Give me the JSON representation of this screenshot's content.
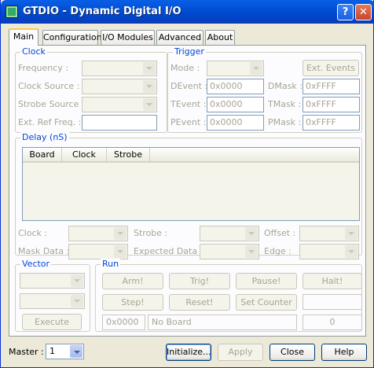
{
  "window": {
    "title": "GTDIO - Dynamic Digital I/O",
    "help_glyph": "?",
    "close_glyph": "✕"
  },
  "tabs": [
    "Main",
    "Configuration",
    "I/O Modules",
    "Advanced",
    "About"
  ],
  "clock": {
    "title": "Clock",
    "frequency": "Frequency :",
    "clock_source": "Clock Source :",
    "strobe_source": "Strobe Source :",
    "ext_ref_freq": "Ext. Ref Freq. :"
  },
  "trigger": {
    "title": "Trigger",
    "mode": "Mode :",
    "ext_events": "Ext. Events",
    "devent": "DEvent :",
    "devent_val": "0x0000",
    "dmask": "DMask :",
    "dmask_val": "0xFFFF",
    "tevent": "TEvent :",
    "tevent_val": "0x0000",
    "tmask": "TMask :",
    "tmask_val": "0xFFFF",
    "pevent": "PEvent :",
    "pevent_val": "0x0000",
    "pmask": "PMask :",
    "pmask_val": "0xFFFF"
  },
  "delay": {
    "title": "Delay (nS)",
    "columns": [
      "Board",
      "Clock",
      "Strobe"
    ],
    "clock": "Clock :",
    "strobe": "Strobe :",
    "offset": "Offset :",
    "mask_data": "Mask Data :",
    "expected_data": "Expected Data :",
    "edge": "Edge :"
  },
  "vector": {
    "title": "Vector",
    "execute": "Execute"
  },
  "run": {
    "title": "Run",
    "arm": "Arm!",
    "trig": "Trig!",
    "pause": "Pause!",
    "halt": "Halt!",
    "step": "Step!",
    "reset": "Reset!",
    "set_counter": "Set Counter",
    "status_hex": "0x0000",
    "status_board": "No Board",
    "status_count": "0"
  },
  "footer": {
    "master_label": "Master :",
    "master_value": "1",
    "initialize": "Initialize...",
    "apply": "Apply",
    "close": "Close",
    "help": "Help"
  },
  "colors": {
    "title_bar": "#0050D3",
    "group_title": "#0046D5",
    "disabled_text": "#A5A595",
    "face": "#ECE9D8"
  }
}
